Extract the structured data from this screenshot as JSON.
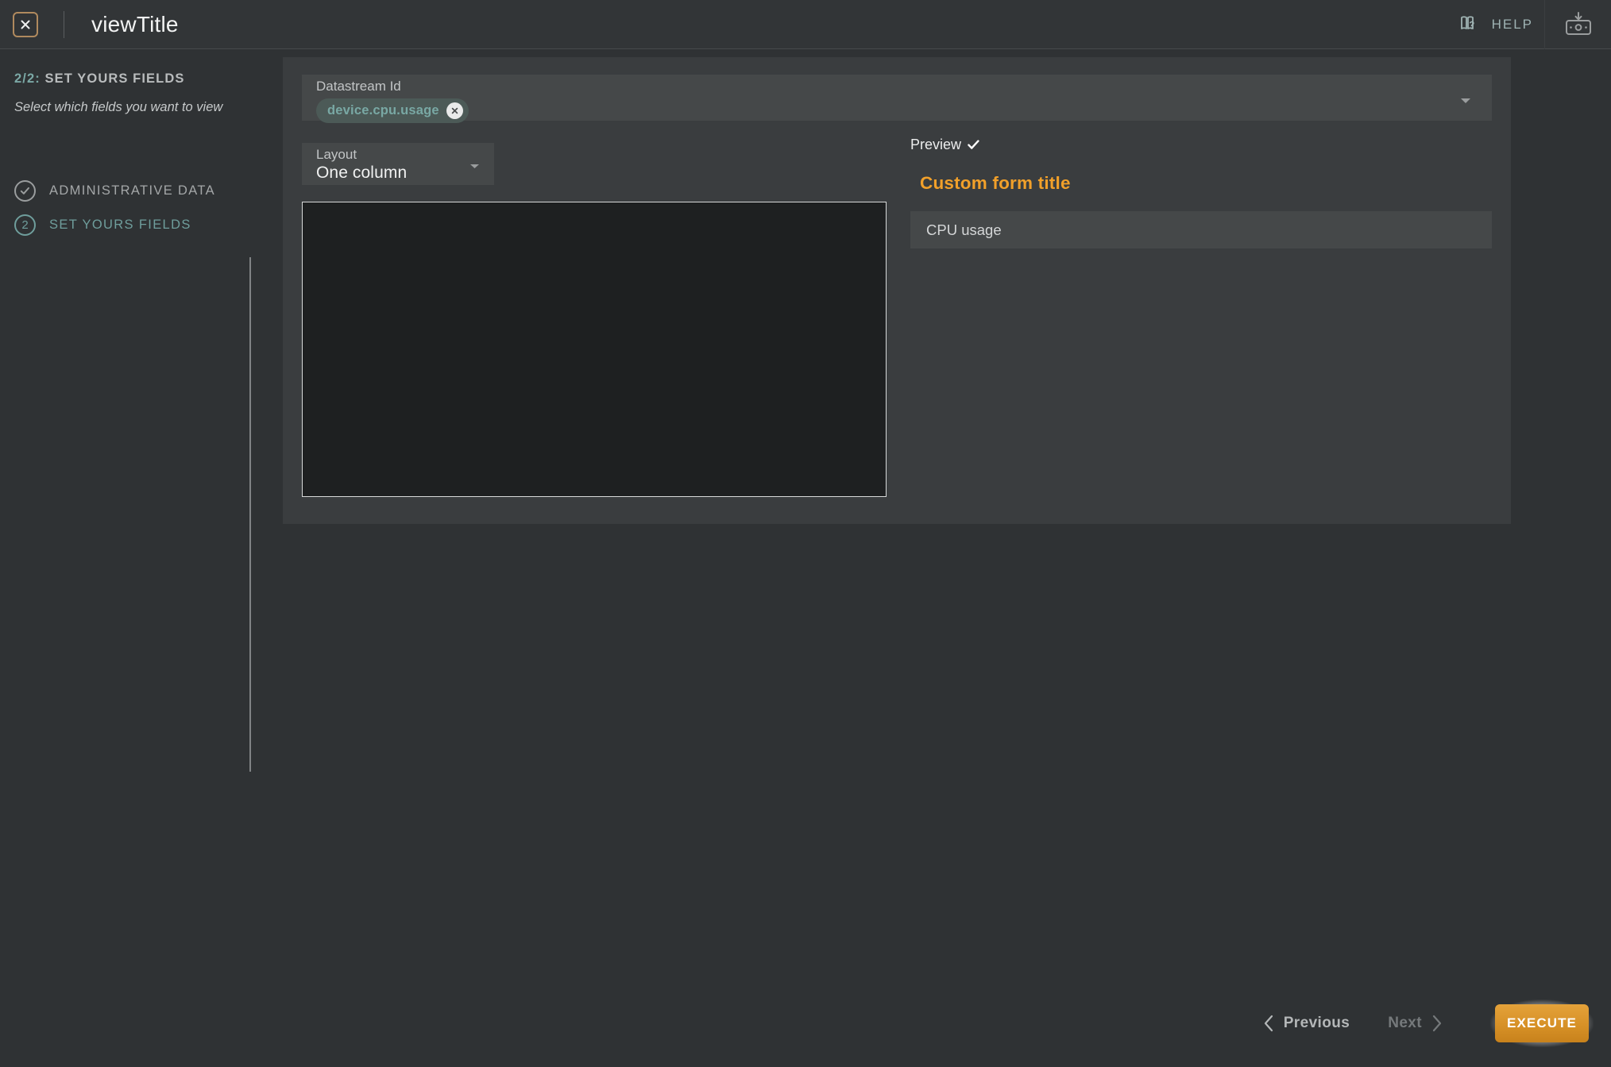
{
  "topbar": {
    "close_icon": "close-x-icon",
    "title": "viewTitle",
    "help_label": "HELP",
    "help_icon": "book-question-icon",
    "device_icon": "device-download-icon"
  },
  "sidebar": {
    "step_counter": "2/2:",
    "step_heading": "SET YOURS FIELDS",
    "step_description": "Select which fields you want to view",
    "steps": [
      {
        "label": "ADMINISTRATIVE DATA",
        "state": "completed",
        "icon": "check-circle-icon"
      },
      {
        "label": "SET YOURS FIELDS",
        "state": "active",
        "number": "2"
      }
    ]
  },
  "form": {
    "datastream": {
      "label": "Datastream Id",
      "chips": [
        {
          "text": "device.cpu.usage",
          "remove_icon": "chip-close-icon"
        }
      ],
      "caret_icon": "chevron-down-icon"
    },
    "layout": {
      "label": "Layout",
      "value": "One column",
      "caret_icon": "chevron-down-icon"
    },
    "editor": {
      "value": "",
      "placeholder": ""
    }
  },
  "preview": {
    "heading": "Preview",
    "check_icon": "check-icon",
    "form_title": "Custom form title",
    "rows": [
      {
        "label": "CPU usage"
      }
    ]
  },
  "footer": {
    "previous_label": "Previous",
    "previous_icon": "chevron-left-icon",
    "next_label": "Next",
    "next_icon": "chevron-right-icon",
    "execute_label": "EXECUTE"
  },
  "colors": {
    "accent_orange": "#f1a02a",
    "accent_teal": "#6f9e9c",
    "panel_bg": "#3a3d3f",
    "app_bg": "#2f3234",
    "field_bg": "#454849",
    "editor_bg": "#1e2021"
  }
}
